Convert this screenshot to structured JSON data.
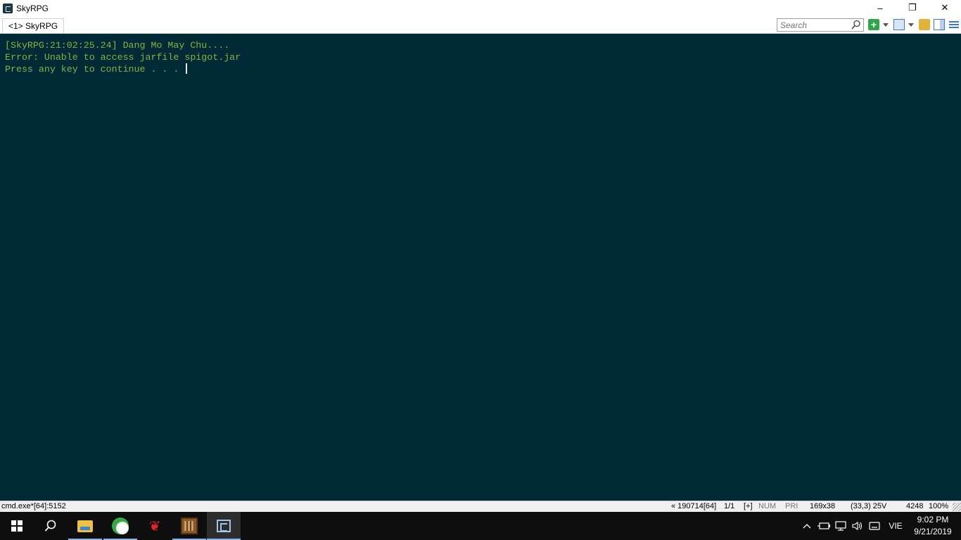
{
  "window": {
    "title": "SkyRPG",
    "controls": {
      "minimize": "–",
      "restore": "❐",
      "close": "✕"
    }
  },
  "tabs": [
    {
      "label": "<1> SkyRPG"
    }
  ],
  "toolbar": {
    "search_placeholder": "Search",
    "icons": [
      "new-console-icon",
      "dropdown-icon",
      "layout-icon",
      "dropdown-icon",
      "lock-icon",
      "split-panel-icon",
      "menu-icon"
    ]
  },
  "console": {
    "background": "#002b36",
    "text_color": "#88b043",
    "lines": [
      "[SkyRPG:21:02:25.24] Dang Mo May Chu....",
      "Error: Unable to access jarfile spigot.jar",
      "Press any key to continue . . . "
    ]
  },
  "statusbar": {
    "process": "cmd.exe*[64]:5152",
    "buffer": "« 190714[64]",
    "pages": "1/1",
    "plus": "[+]",
    "num": "NUM",
    "pri": "PRI",
    "size": "169x38",
    "cursor_pos": "(33,3) 25V",
    "pid": "4248",
    "zoom": "100%"
  },
  "taskbar": {
    "apps": [
      "start-icon",
      "search-icon",
      "file-explorer-icon",
      "chrome-icon",
      "garena-icon",
      "minecraft-icon",
      "conemu-icon"
    ],
    "language": "VIE",
    "time": "9:02 PM",
    "date": "9/21/2019"
  }
}
